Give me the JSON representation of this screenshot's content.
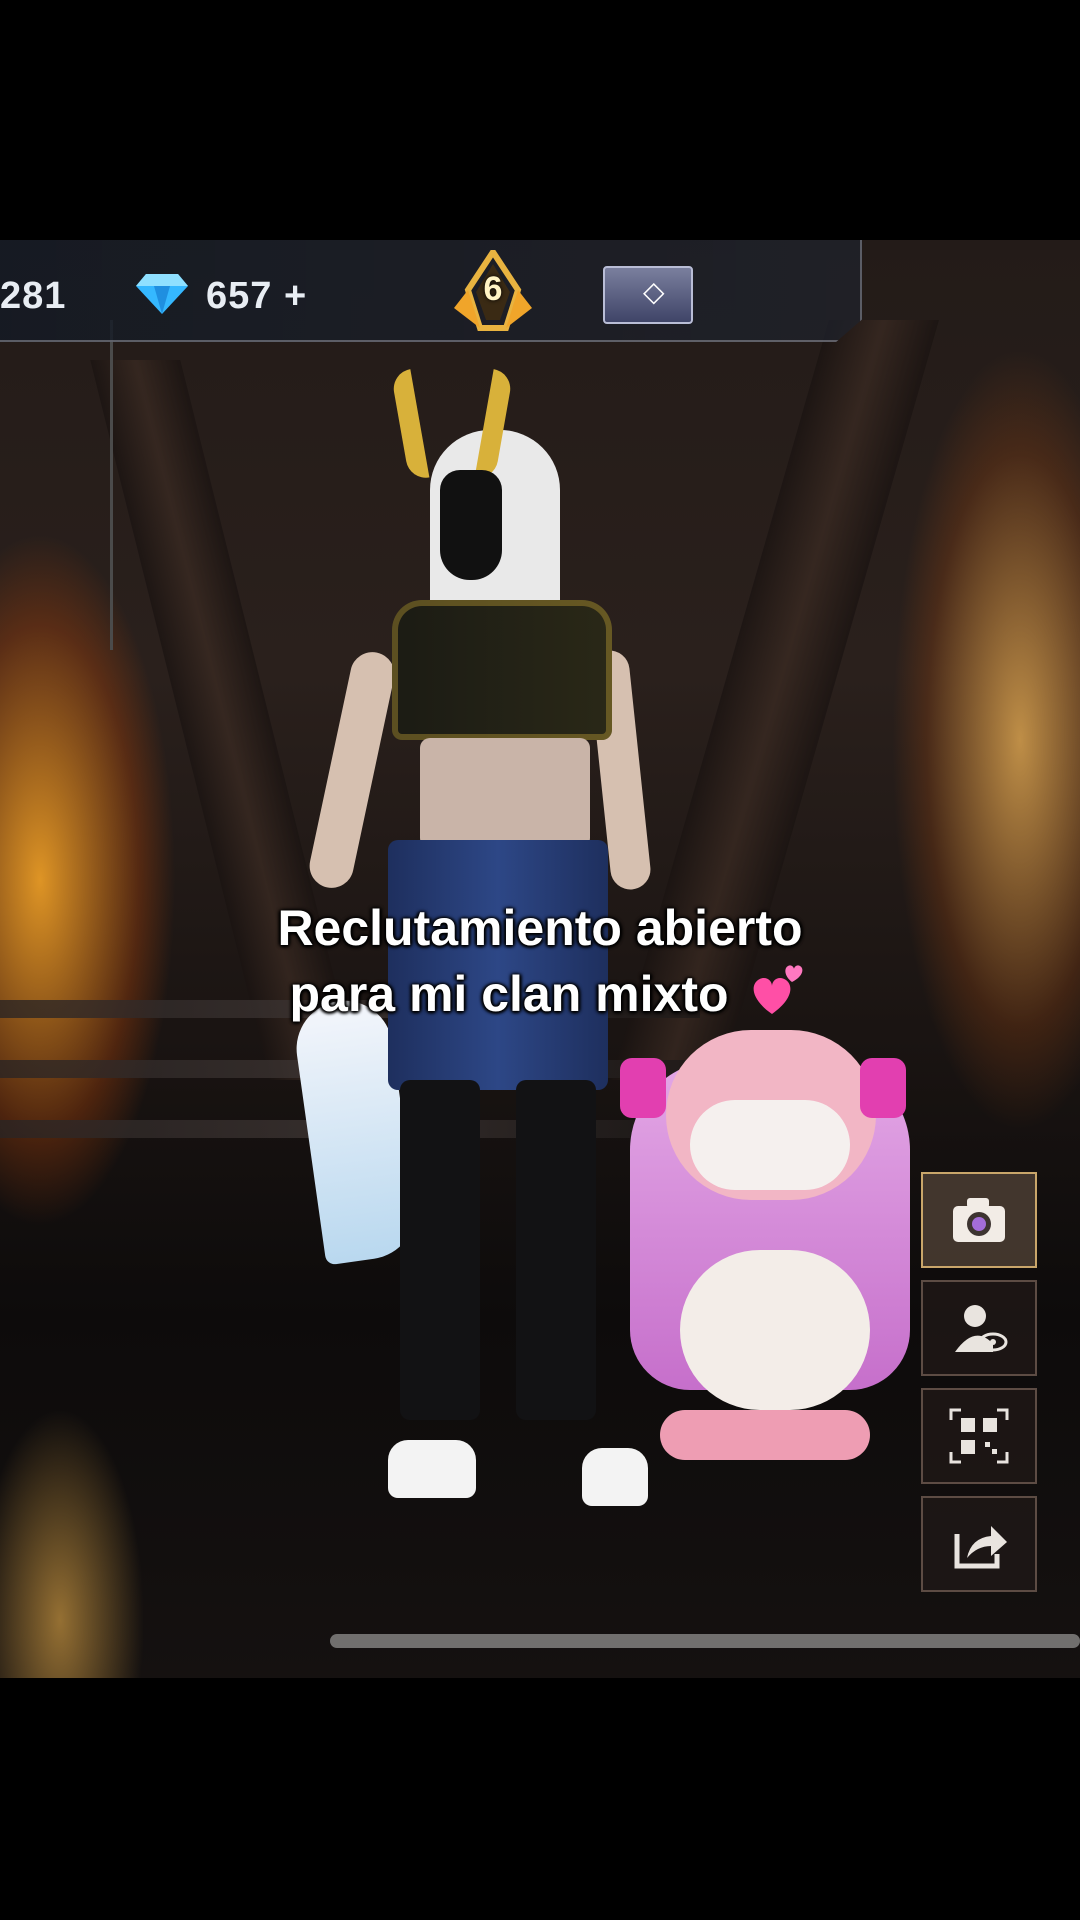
{
  "hud": {
    "gold_count": "281",
    "diamond_count": "657",
    "diamond_add_label": "+",
    "rank_level": "6",
    "diamond_icon": "diamond-icon",
    "rank_icon": "rank-badge-icon",
    "vip_icon": "vip-card-icon"
  },
  "caption": {
    "line1": "Reclutamiento abierto",
    "line2": "para mi clan mixto",
    "emoji": "heart-emoji-icon"
  },
  "side_buttons": [
    {
      "icon": "camera-icon"
    },
    {
      "icon": "profile-view-icon"
    },
    {
      "icon": "qr-code-icon"
    },
    {
      "icon": "share-icon"
    }
  ],
  "colors": {
    "accent_gold": "#d8b13a",
    "diamond_blue": "#35b8ff",
    "heart_pink": "#ff4fa6"
  }
}
